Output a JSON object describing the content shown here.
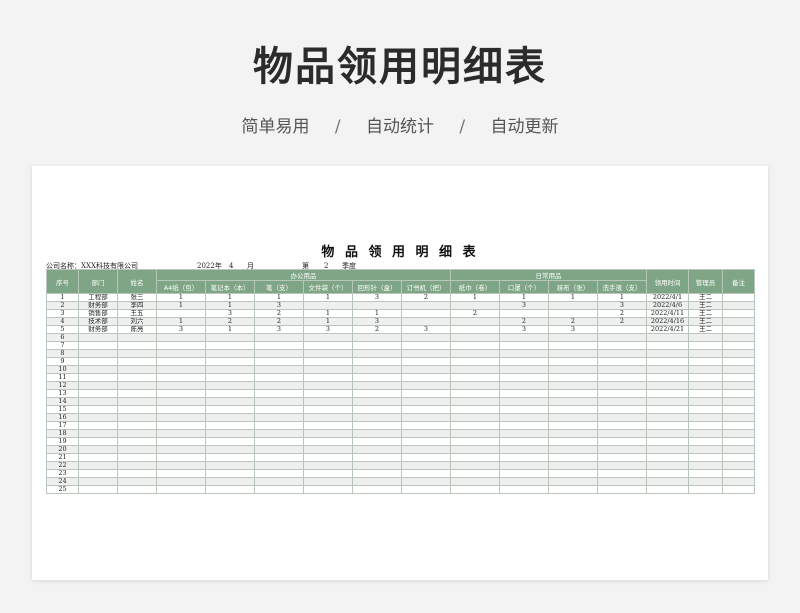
{
  "hero": {
    "title": "物品领用明细表",
    "subtitles": [
      "简单易用",
      "自动统计",
      "自动更新"
    ],
    "separator": "/"
  },
  "sheet": {
    "title": "物 品 领 用 明 细 表",
    "company_label": "公司名称：XXX科技有限公司",
    "year_text": "2022年",
    "month_value": "4",
    "month_unit": "月",
    "quarter_prefix": "第",
    "quarter_value": "2",
    "quarter_unit": "季度"
  },
  "colors": {
    "header_green": "#7ea586",
    "stripe_gray": "#efefef"
  },
  "table": {
    "headers": {
      "seq": "序号",
      "dept": "部门",
      "name": "姓名",
      "office_group": "办公用品",
      "daily_group": "日常用品",
      "date": "领用时间",
      "admin": "管理员",
      "note": "备注"
    },
    "subheaders": [
      "A4纸（包）",
      "笔记本（本）",
      "笔（支）",
      "文件袋（个）",
      "回形针（盒）",
      "订书机（把）",
      "纸巾（卷）",
      "口罩（个）",
      "抹布（张）",
      "洗手液（支）"
    ],
    "rows": [
      [
        "1",
        "工程部",
        "张三",
        "1",
        "1",
        "1",
        "1",
        "3",
        "2",
        "1",
        "1",
        "1",
        "1",
        "2022/4/1",
        "王二",
        ""
      ],
      [
        "2",
        "财务部",
        "李四",
        "1",
        "1",
        "3",
        "",
        "",
        "",
        "",
        "3",
        "",
        "3",
        "2022/4/6",
        "王二",
        ""
      ],
      [
        "3",
        "销售部",
        "王五",
        "",
        "3",
        "2",
        "1",
        "1",
        "",
        "2",
        "",
        "",
        "2",
        "2022/4/11",
        "王二",
        ""
      ],
      [
        "4",
        "技术部",
        "刘六",
        "1",
        "2",
        "2",
        "1",
        "3",
        "",
        "",
        "2",
        "2",
        "2",
        "2022/4/16",
        "王二",
        ""
      ],
      [
        "5",
        "财务部",
        "陈亮",
        "3",
        "1",
        "3",
        "3",
        "2",
        "3",
        "",
        "3",
        "3",
        "",
        "2022/4/21",
        "王二",
        ""
      ],
      [
        "6",
        "",
        "",
        "",
        "",
        "",
        "",
        "",
        "",
        "",
        "",
        "",
        "",
        "",
        "",
        ""
      ],
      [
        "7",
        "",
        "",
        "",
        "",
        "",
        "",
        "",
        "",
        "",
        "",
        "",
        "",
        "",
        "",
        ""
      ],
      [
        "8",
        "",
        "",
        "",
        "",
        "",
        "",
        "",
        "",
        "",
        "",
        "",
        "",
        "",
        "",
        ""
      ],
      [
        "9",
        "",
        "",
        "",
        "",
        "",
        "",
        "",
        "",
        "",
        "",
        "",
        "",
        "",
        "",
        ""
      ],
      [
        "10",
        "",
        "",
        "",
        "",
        "",
        "",
        "",
        "",
        "",
        "",
        "",
        "",
        "",
        "",
        ""
      ],
      [
        "11",
        "",
        "",
        "",
        "",
        "",
        "",
        "",
        "",
        "",
        "",
        "",
        "",
        "",
        "",
        ""
      ],
      [
        "12",
        "",
        "",
        "",
        "",
        "",
        "",
        "",
        "",
        "",
        "",
        "",
        "",
        "",
        "",
        ""
      ],
      [
        "13",
        "",
        "",
        "",
        "",
        "",
        "",
        "",
        "",
        "",
        "",
        "",
        "",
        "",
        "",
        ""
      ],
      [
        "14",
        "",
        "",
        "",
        "",
        "",
        "",
        "",
        "",
        "",
        "",
        "",
        "",
        "",
        "",
        ""
      ],
      [
        "15",
        "",
        "",
        "",
        "",
        "",
        "",
        "",
        "",
        "",
        "",
        "",
        "",
        "",
        "",
        ""
      ],
      [
        "16",
        "",
        "",
        "",
        "",
        "",
        "",
        "",
        "",
        "",
        "",
        "",
        "",
        "",
        "",
        ""
      ],
      [
        "17",
        "",
        "",
        "",
        "",
        "",
        "",
        "",
        "",
        "",
        "",
        "",
        "",
        "",
        "",
        ""
      ],
      [
        "18",
        "",
        "",
        "",
        "",
        "",
        "",
        "",
        "",
        "",
        "",
        "",
        "",
        "",
        "",
        ""
      ],
      [
        "19",
        "",
        "",
        "",
        "",
        "",
        "",
        "",
        "",
        "",
        "",
        "",
        "",
        "",
        "",
        ""
      ],
      [
        "20",
        "",
        "",
        "",
        "",
        "",
        "",
        "",
        "",
        "",
        "",
        "",
        "",
        "",
        "",
        ""
      ],
      [
        "21",
        "",
        "",
        "",
        "",
        "",
        "",
        "",
        "",
        "",
        "",
        "",
        "",
        "",
        "",
        ""
      ],
      [
        "22",
        "",
        "",
        "",
        "",
        "",
        "",
        "",
        "",
        "",
        "",
        "",
        "",
        "",
        "",
        ""
      ],
      [
        "23",
        "",
        "",
        "",
        "",
        "",
        "",
        "",
        "",
        "",
        "",
        "",
        "",
        "",
        "",
        ""
      ],
      [
        "24",
        "",
        "",
        "",
        "",
        "",
        "",
        "",
        "",
        "",
        "",
        "",
        "",
        "",
        "",
        ""
      ],
      [
        "25",
        "",
        "",
        "",
        "",
        "",
        "",
        "",
        "",
        "",
        "",
        "",
        "",
        "",
        "",
        ""
      ]
    ]
  }
}
